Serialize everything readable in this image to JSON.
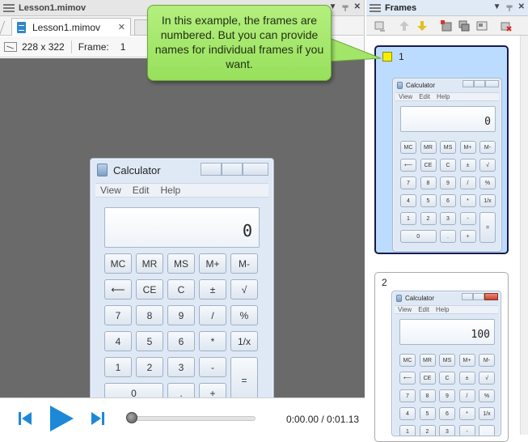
{
  "left_panel": {
    "title": "Lesson1.mimov",
    "tab_label": "Lesson1.mimov",
    "dimensions": "228 x 322",
    "frame_label": "Frame:",
    "frame_value": "1",
    "timecode": "0:00.00 / 0:01.13",
    "progress_fraction": 0.0
  },
  "callout": {
    "text": "In this example, the frames are numbered. But you can provide names for individual frames if you want."
  },
  "frames_panel": {
    "title": "Frames",
    "frames": [
      {
        "number": "1",
        "selected": true,
        "display": "0"
      },
      {
        "number": "2",
        "selected": false,
        "display": "100"
      }
    ]
  },
  "calculator": {
    "title": "Calculator",
    "menu": [
      "View",
      "Edit",
      "Help"
    ],
    "display": "0",
    "keys": {
      "mc": "MC",
      "mr": "MR",
      "ms": "MS",
      "mplus": "M+",
      "mminus": "M-",
      "back": "⟵",
      "ce": "CE",
      "c": "C",
      "pm": "±",
      "sqrt": "√",
      "n7": "7",
      "n8": "8",
      "n9": "9",
      "div": "/",
      "pct": "%",
      "n4": "4",
      "n5": "5",
      "n6": "6",
      "mul": "*",
      "inv": "1/x",
      "n1": "1",
      "n2": "2",
      "n3": "3",
      "sub": "-",
      "eq": "=",
      "n0": "0",
      "dot": ".",
      "add": "+"
    }
  },
  "colors": {
    "callout_green": "#a6e86e",
    "selected_frame": "#bcdcff",
    "play_blue": "#1e88d8",
    "frame_marker": "#f7f000"
  }
}
